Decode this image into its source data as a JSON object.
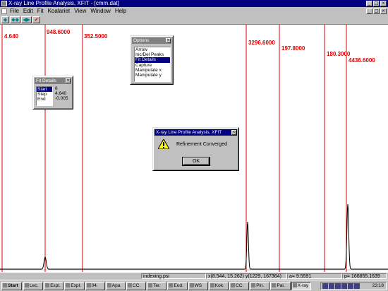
{
  "window": {
    "title": "X-ray Line Profile Analysis, XFIT  - [cmm.dat]"
  },
  "window_buttons": [
    "_",
    "□",
    "×"
  ],
  "menu": [
    "File",
    "Edit",
    "Fit",
    "Koalariet",
    "View",
    "Window",
    "Help"
  ],
  "mdi_buttons": [
    "_",
    "□",
    "×"
  ],
  "toolbar": [
    {
      "icon": "diamond-icon",
      "glyph": "◆"
    },
    {
      "icon": "double-arrow-icon",
      "glyph": "◆◆"
    },
    {
      "icon": "split-arrow-icon",
      "glyph": "◀▶"
    },
    {
      "icon": "checkmark-icon",
      "glyph": "✔"
    }
  ],
  "peak_labels": [
    "4.640",
    "948.6000",
    "352.5000",
    "3296.6000",
    "197.8000",
    "180.3000",
    "4436.6000"
  ],
  "plot": {
    "line_color": "#e00000"
  },
  "options_dialog": {
    "title": "Options",
    "items": [
      "Arrow",
      "Inc/Del Peaks",
      "Fit Details",
      "Capture",
      "Manipulate x",
      "Manipulate y"
    ],
    "selected": "Fit Details"
  },
  "fit_details_dialog": {
    "title": "Fit Details",
    "labels": [
      "Start",
      "Step",
      "End"
    ],
    "selected_label": "Start",
    "values": [
      "6",
      "4.640",
      "-0.005"
    ]
  },
  "message_box": {
    "title": "X-ray Line Profile Analysis, XFIT",
    "icon": "warning-icon",
    "message": "Refinement Converged",
    "ok_label": "OK"
  },
  "status": {
    "mode": "indexing.psi",
    "coords": "x(8.544, 15.262) y(1229, 167364)",
    "a_value": "a= 9.5591",
    "p_value": "p= 166855.1639"
  },
  "taskbar": {
    "start": "Start",
    "items": [
      "Lec.",
      "Expl.",
      "Expl.",
      "04.",
      "Apa.",
      "CC.",
      "Ter.",
      "Eud.",
      "WS",
      "Kok.",
      "CC.",
      "Pin.",
      "Pai.",
      "X-ray"
    ],
    "active": "X-ray",
    "clock": "23:18"
  }
}
